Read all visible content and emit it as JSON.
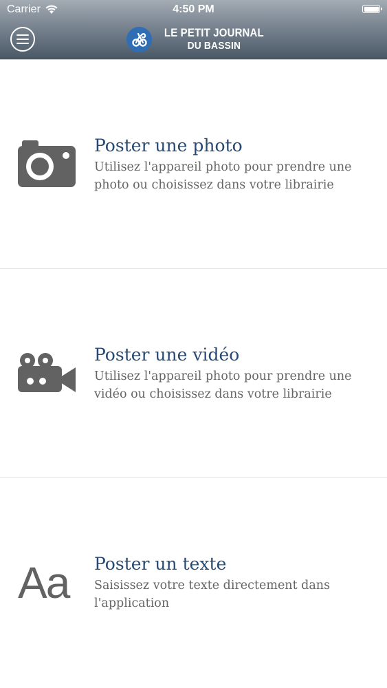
{
  "status_bar": {
    "carrier": "Carrier",
    "time": "4:50 PM"
  },
  "header": {
    "logo_line1": "LE PETIT JOURNAL",
    "logo_line2": "DU BASSIN",
    "menu_icon": "hamburger-icon"
  },
  "options": [
    {
      "icon": "camera-icon",
      "title": "Poster une photo",
      "description": "Utilisez l'appareil photo pour prendre une photo ou choisissez dans votre librairie"
    },
    {
      "icon": "video-camera-icon",
      "title": "Poster une vidéo",
      "description": "Utilisez l'appareil photo pour prendre une vidéo ou choisissez dans votre librairie"
    },
    {
      "icon": "text-icon",
      "icon_text": "Aa",
      "title": "Poster un texte",
      "description": "Saisissez votre texte directement dans l'application"
    }
  ],
  "colors": {
    "title": "#284a72",
    "description": "#666666",
    "icon": "#626262",
    "logo_emblem": "#2f6db5"
  }
}
